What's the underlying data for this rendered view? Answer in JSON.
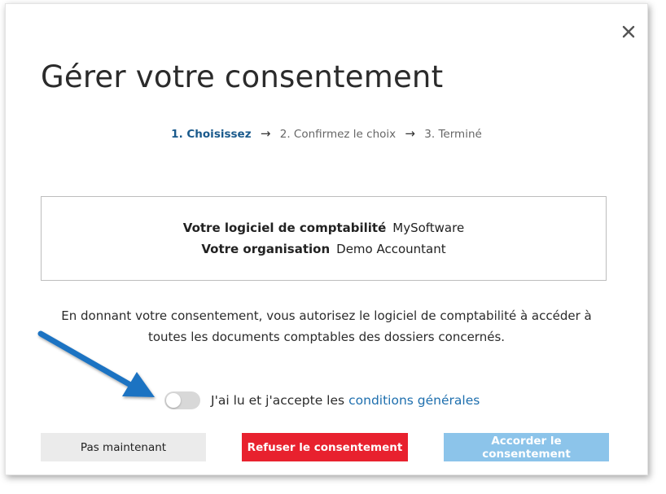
{
  "dialog": {
    "title": "Gérer votre consentement",
    "close_icon": "close-icon"
  },
  "steps": {
    "step1": "1. Choisissez",
    "arrow": "→",
    "step2": "2. Confirmez le choix",
    "step3": "3. Terminé"
  },
  "info": {
    "software_label": "Votre logiciel de comptabilité",
    "software_value": "MySoftware",
    "org_label": "Votre organisation",
    "org_value": "Demo Accountant"
  },
  "description": {
    "line1": "En donnant votre consentement, vous autorisez le logiciel de comptabilité à accéder à",
    "line2": "toutes les documents comptables des dossiers concernés."
  },
  "consent": {
    "toggle_on": false,
    "text": "J'ai lu et j'accepte les",
    "link": "conditions générales"
  },
  "buttons": {
    "later": "Pas maintenant",
    "refuse": "Refuser le consentement",
    "grant": "Accorder le consentement"
  },
  "colors": {
    "accent": "#1a5a8c",
    "link": "#1e6fae",
    "refuse": "#e8212e",
    "grant_disabled": "#8cc4ea",
    "pointer_arrow": "#1f73c2"
  }
}
